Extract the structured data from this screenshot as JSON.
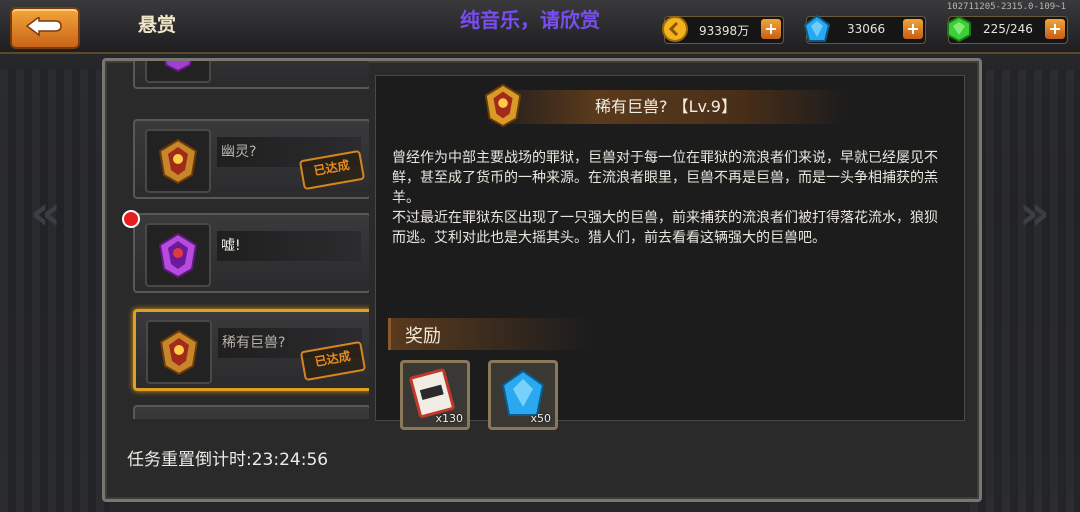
{
  "header": {
    "title": "悬赏",
    "music_notice": "纯音乐，请欣赏",
    "build_id": "102711205-2315.0-109~1"
  },
  "resources": [
    {
      "name": "gold",
      "value": "93398万",
      "color": "#f4b21f",
      "icon": "gold-coin-icon"
    },
    {
      "name": "diamond",
      "value": "33066",
      "color": "#2aa8f0",
      "icon": "blue-gem-icon"
    },
    {
      "name": "energy",
      "value": "225/246",
      "color": "#3ccf3a",
      "icon": "green-gem-icon"
    }
  ],
  "plus_label": "+",
  "quests": [
    {
      "title": "幽灵?",
      "stamp": "已达成",
      "badge": "gold-badge-icon"
    },
    {
      "title": "嘘!",
      "stamp": "",
      "badge": "purple-badge-icon"
    },
    {
      "title": "稀有巨兽?",
      "stamp": "已达成",
      "badge": "gold-badge-icon"
    }
  ],
  "detail": {
    "title": "稀有巨兽? 【Lv.9】",
    "description": "曾经作为中部主要战场的罪狱，巨兽对于每一位在罪狱的流浪者们来说，早就已经屡见不鲜，甚至成了货币的一种来源。在流浪者眼里，巨兽不再是巨兽，而是一头争相捕获的羔羊。\n不过最近在罪狱东区出现了一只强大的巨兽，前来捕获的流浪者们被打得落花流水，狼狈而逃。艾利对此也是大摇其头。猎人们，前去看看这辆强大的巨兽吧。",
    "reward_title": "奖励",
    "rewards": [
      {
        "name": "ticket",
        "qty": "x130",
        "icon": "ticket-icon"
      },
      {
        "name": "diamond",
        "qty": "x50",
        "icon": "blue-gem-icon"
      }
    ]
  },
  "countdown": "任务重置倒计时:23:24:56",
  "colors": {
    "accent": "#e0a020",
    "stamp": "#e88c1e",
    "music": "#7a4df0"
  }
}
